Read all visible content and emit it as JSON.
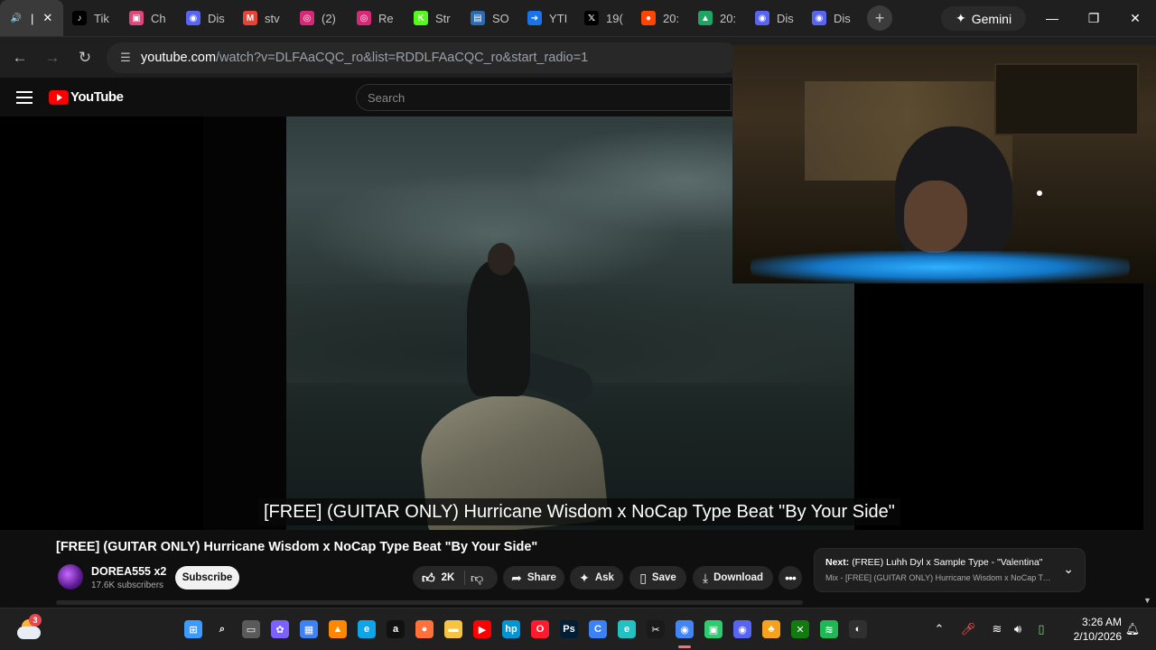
{
  "browser": {
    "tabs": [
      {
        "label": "|",
        "favicon": "speaker-icon",
        "color": "#3a3a3a",
        "glyph": "🔊",
        "active": true
      },
      {
        "label": "Tik",
        "favicon": "tiktok-icon",
        "color": "#000000",
        "glyph": "♪"
      },
      {
        "label": "Ch",
        "favicon": "chat-icon",
        "color": "#e0467c",
        "glyph": "▣"
      },
      {
        "label": "Dis",
        "favicon": "discord-icon",
        "color": "#5865f2",
        "glyph": "◉"
      },
      {
        "label": "stv",
        "favicon": "gmail-icon",
        "color": "#ea4335",
        "glyph": "M"
      },
      {
        "label": "(2)",
        "favicon": "instagram-icon",
        "color": "#d62976",
        "glyph": "◎"
      },
      {
        "label": "Re",
        "favicon": "instagram-icon",
        "color": "#d62976",
        "glyph": "◎"
      },
      {
        "label": "Str",
        "favicon": "kick-icon",
        "color": "#53fc18",
        "glyph": "K"
      },
      {
        "label": "SO",
        "favicon": "photo-icon",
        "color": "#2b6cb0",
        "glyph": "▤"
      },
      {
        "label": "YTI",
        "favicon": "ytinsight-icon",
        "color": "#1a73e8",
        "glyph": "➜"
      },
      {
        "label": "19(",
        "favicon": "x-icon",
        "color": "#000000",
        "glyph": "𝕏"
      },
      {
        "label": "20:",
        "favicon": "reddit-icon",
        "color": "#ff4500",
        "glyph": "●"
      },
      {
        "label": "20:",
        "favicon": "drive-icon",
        "color": "#1fa463",
        "glyph": "▲"
      },
      {
        "label": "Dis",
        "favicon": "discord-icon",
        "color": "#5865f2",
        "glyph": "◉"
      },
      {
        "label": "Dis",
        "favicon": "discord-icon",
        "color": "#5865f2",
        "glyph": "◉"
      }
    ],
    "gemini_label": "Gemini",
    "url_host": "youtube.com",
    "url_path": "/watch?v=DLFAaCQC_ro&list=RDDLFAaCQC_ro&start_radio=1"
  },
  "youtube": {
    "logo_text": "YouTube",
    "search_placeholder": "Search",
    "caption": "[FREE] (GUITAR ONLY) Hurricane Wisdom x NoCap Type Beat \"By Your Side\"",
    "video_title": "[FREE] (GUITAR ONLY) Hurricane Wisdom x NoCap Type Beat \"By Your Side\"",
    "channel_name": "DOREA555 x2",
    "subscribers": "17.6K subscribers",
    "subscribe_label": "Subscribe",
    "like_count": "2K",
    "share_label": "Share",
    "ask_label": "Ask",
    "save_label": "Save",
    "download_label": "Download",
    "next_prefix": "Next:",
    "next_title": "(FREE) Luhh Dyl x Sample Type - \"Valentina\"",
    "next_sub": "Mix - [FREE] (GUITAR ONLY) Hurricane Wisdom x NoCap Typ..."
  },
  "taskbar": {
    "weather_badge": "3",
    "apps": [
      {
        "name": "start-icon",
        "color": "#3b9bff",
        "glyph": "⊞"
      },
      {
        "name": "search-icon",
        "color": "#202020",
        "glyph": "⌕"
      },
      {
        "name": "task-view-icon",
        "color": "#5a5a5a",
        "glyph": "▭"
      },
      {
        "name": "copilot-icon",
        "color": "#7b61ff",
        "glyph": "✿"
      },
      {
        "name": "store-icon",
        "color": "#3b82f6",
        "glyph": "▦"
      },
      {
        "name": "vlc-icon",
        "color": "#ff8800",
        "glyph": "▲"
      },
      {
        "name": "edge-icon",
        "color": "#0ea5e9",
        "glyph": "e"
      },
      {
        "name": "amazon-icon",
        "color": "#111111",
        "glyph": "a"
      },
      {
        "name": "firefox-icon",
        "color": "#ff7139",
        "glyph": "●"
      },
      {
        "name": "explorer-icon",
        "color": "#f5c443",
        "glyph": "▬"
      },
      {
        "name": "youtube-icon",
        "color": "#ff0000",
        "glyph": "▶"
      },
      {
        "name": "hp-icon",
        "color": "#0096d6",
        "glyph": "hp"
      },
      {
        "name": "opera-icon",
        "color": "#ff1b2d",
        "glyph": "O"
      },
      {
        "name": "photoshop-icon",
        "color": "#001e36",
        "glyph": "Ps"
      },
      {
        "name": "capcut-icon",
        "color": "#3b82f6",
        "glyph": "C"
      },
      {
        "name": "edge-icon-2",
        "color": "#22c1c3",
        "glyph": "e"
      },
      {
        "name": "capcut-icon-2",
        "color": "#1a1a1a",
        "glyph": "✂"
      },
      {
        "name": "chrome-icon",
        "color": "#4285f4",
        "glyph": "◉",
        "active": true
      },
      {
        "name": "android-icon",
        "color": "#2ecc71",
        "glyph": "▣"
      },
      {
        "name": "discord-icon",
        "color": "#5865f2",
        "glyph": "◉"
      },
      {
        "name": "fruity-icon",
        "color": "#f7a21b",
        "glyph": "♣"
      },
      {
        "name": "xbox-icon",
        "color": "#107c10",
        "glyph": "✕"
      },
      {
        "name": "spotify-icon",
        "color": "#1db954",
        "glyph": "≋"
      },
      {
        "name": "obs-icon",
        "color": "#303030",
        "glyph": "◐"
      }
    ],
    "time": "3:26 AM",
    "date": "2/10/2026"
  }
}
